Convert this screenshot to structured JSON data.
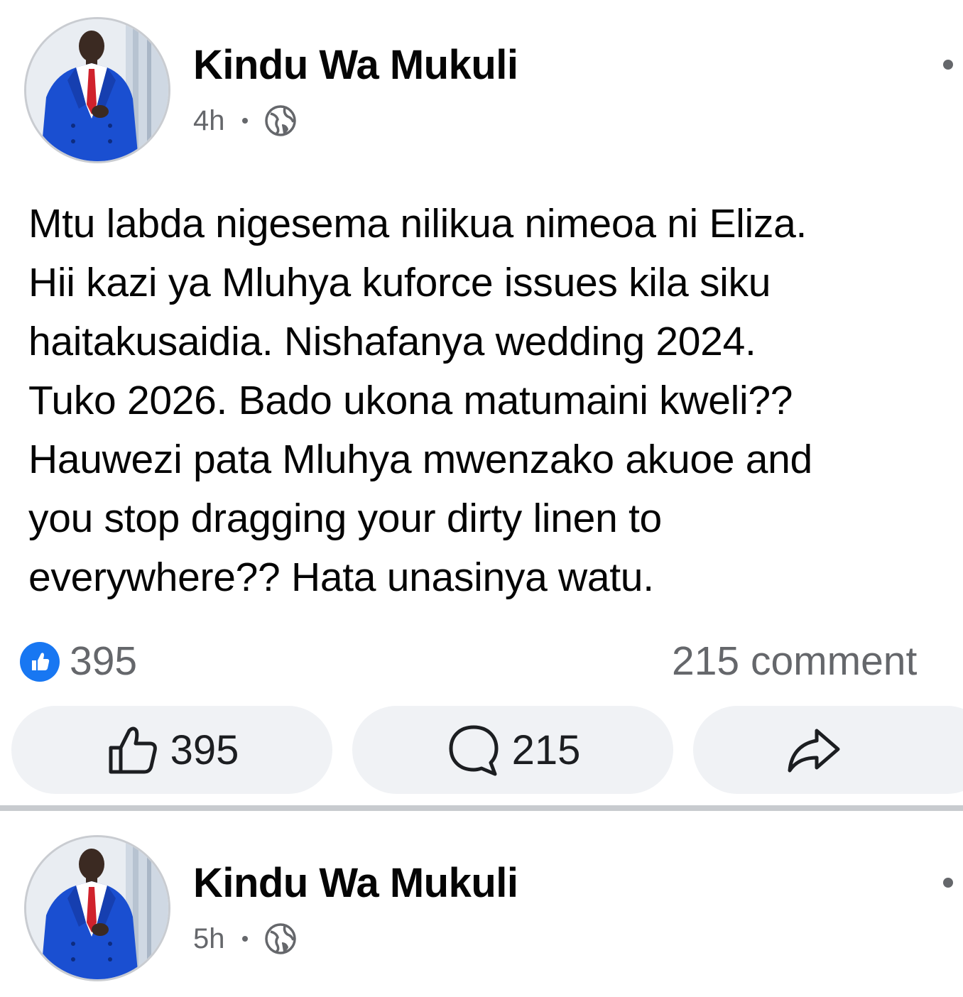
{
  "posts": [
    {
      "author": "Kindu Wa Mukuli",
      "time": "4h",
      "privacy_icon": "globe-icon",
      "text": "Mtu labda nigesema nilikua nimeoa ni Eliza.\nHii kazi ya Mluhya kuforce issues kila siku\nhaitakusaidia. Nishafanya wedding 2024.\nTuko 2026. Bado ukona matumaini kweli??\nHauwezi pata Mluhya mwenzako akuoe and\nyou stop dragging your dirty linen to\neverywhere?? Hata unasinya watu.",
      "reactions_count": "395",
      "comments_summary": "215 comment",
      "actions": {
        "like_count": "395",
        "comment_count": "215"
      }
    },
    {
      "author": "Kindu Wa Mukuli",
      "time": "5h",
      "privacy_icon": "globe-icon"
    }
  ],
  "colors": {
    "brand_blue": "#1877f2",
    "secondary_text": "#65676b",
    "button_bg": "#f0f2f5",
    "separator": "#c8cbcf"
  }
}
